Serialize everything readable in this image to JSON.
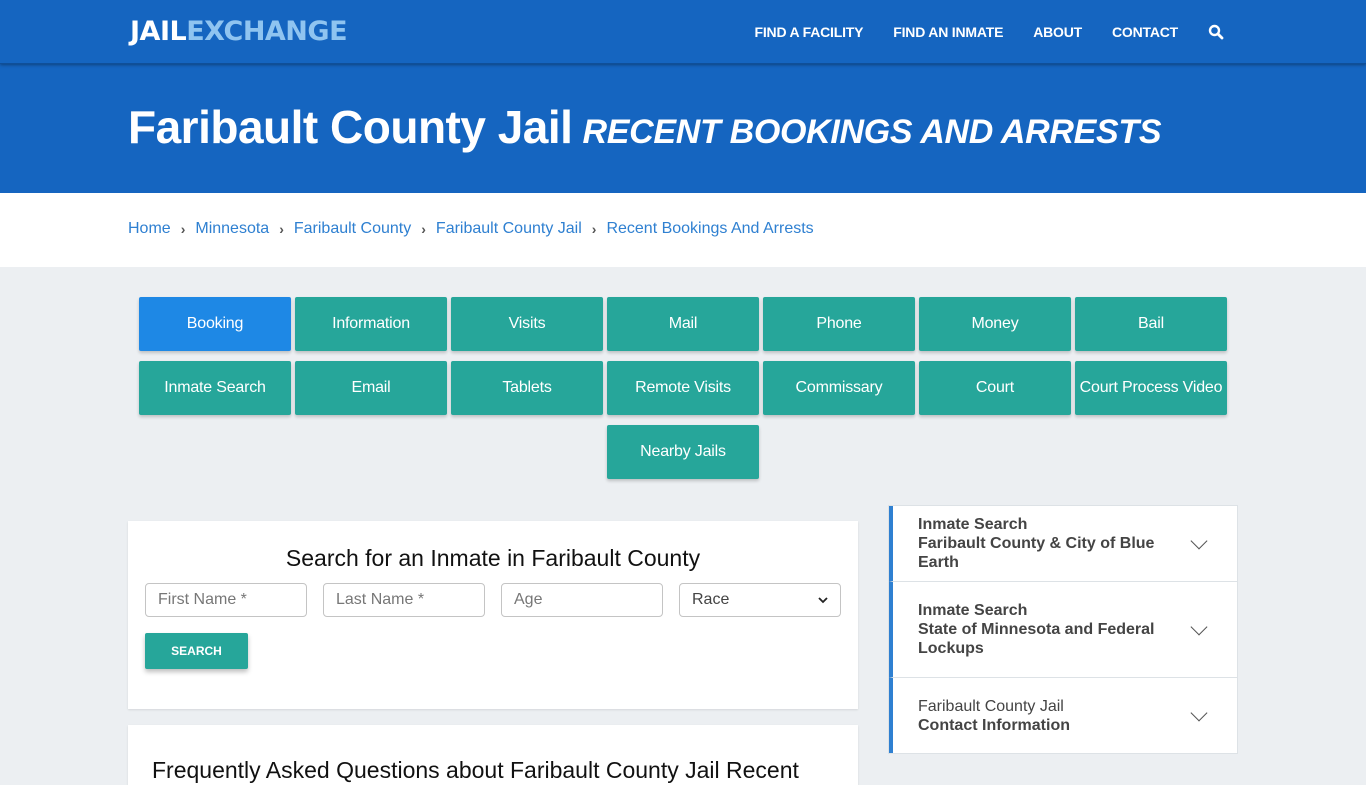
{
  "brand": {
    "logo_part1": "JAIL",
    "logo_part2": "EXCHANGE"
  },
  "nav": {
    "items": [
      {
        "label": "FIND A FACILITY"
      },
      {
        "label": "FIND AN INMATE"
      },
      {
        "label": "ABOUT"
      },
      {
        "label": "CONTACT"
      }
    ],
    "search_icon": "search-icon"
  },
  "hero": {
    "title": "Faribault County Jail",
    "subtitle": "RECENT BOOKINGS AND ARRESTS"
  },
  "breadcrumb": [
    {
      "label": "Home"
    },
    {
      "label": "Minnesota"
    },
    {
      "label": "Faribault County"
    },
    {
      "label": "Faribault County Jail"
    },
    {
      "label": "Recent Bookings And Arrests"
    }
  ],
  "tiles": [
    {
      "label": "Booking",
      "active": true
    },
    {
      "label": "Information"
    },
    {
      "label": "Visits"
    },
    {
      "label": "Mail"
    },
    {
      "label": "Phone"
    },
    {
      "label": "Money"
    },
    {
      "label": "Bail"
    },
    {
      "label": "Inmate Search"
    },
    {
      "label": "Email"
    },
    {
      "label": "Tablets"
    },
    {
      "label": "Remote Visits"
    },
    {
      "label": "Commissary"
    },
    {
      "label": "Court"
    },
    {
      "label": "Court Process Video"
    },
    {
      "label": "Nearby Jails"
    }
  ],
  "colors": {
    "header_blue": "#1565c0",
    "tile_teal": "#26a69a",
    "tile_active_blue": "#1e88e5",
    "link_blue": "#2f80d1",
    "accent_bar": "#2f80d1",
    "page_bg": "#eceff2"
  },
  "search": {
    "heading": "Search for an Inmate in Faribault County",
    "first_name_placeholder": "First Name *",
    "last_name_placeholder": "Last Name *",
    "age_placeholder": "Age",
    "race_selected": "Race",
    "button_label": "SEARCH"
  },
  "faq": {
    "heading": "Frequently Asked Questions about Faribault County Jail Recent"
  },
  "sidebar": {
    "items": [
      {
        "line1": "Inmate Search",
        "line2": "Faribault County & City of Blue Earth"
      },
      {
        "line1": "Inmate Search",
        "line2": "State of Minnesota and Federal Lockups"
      },
      {
        "line1": "Faribault County Jail",
        "line2": "Contact Information"
      }
    ]
  }
}
